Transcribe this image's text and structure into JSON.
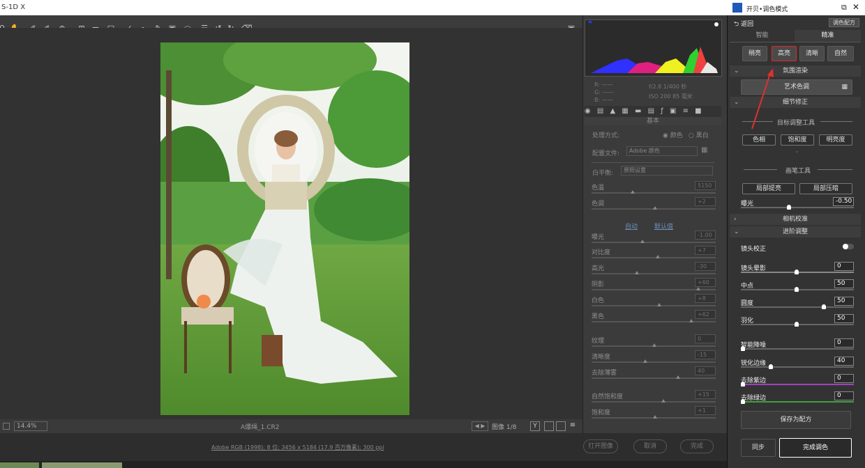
{
  "app": {
    "title": "S-1D X"
  },
  "bottombar": {
    "zoom": "14.4%",
    "filename": "A爆绳_1.CR2",
    "image_count": "图像 1/8"
  },
  "statusbar": {
    "info": "Adobe RGB (1998); 8 位; 3456 x 5184 (17.9 百万像素); 300 ppi",
    "open_label": "打开图像",
    "cancel_label": "取消",
    "done_label": "完成"
  },
  "histogram": {
    "r": "R:",
    "g": "G:",
    "b": "B:",
    "dash": "——",
    "aperture": "f/2.8  1/400 秒",
    "iso": "ISO 200  85 毫米"
  },
  "basic": {
    "section": "基本",
    "process_label": "处理方式:",
    "color": "颜色",
    "bw": "黑白",
    "profile_label": "配置文件:",
    "profile": "Adobe 颜色",
    "wb_label": "白平衡:",
    "wb_value": "原照设置",
    "auto": "自动",
    "default": "默认值",
    "sliders": [
      {
        "label": "色温",
        "value": "5150"
      },
      {
        "label": "色调",
        "value": "+2"
      },
      {
        "label": "曝光",
        "value": "-1.00"
      },
      {
        "label": "对比度",
        "value": "+7"
      },
      {
        "label": "高光",
        "value": "-30"
      },
      {
        "label": "阴影",
        "value": "+60"
      },
      {
        "label": "白色",
        "value": "+8"
      },
      {
        "label": "黑色",
        "value": "+62"
      },
      {
        "label": "纹理",
        "value": "0"
      },
      {
        "label": "清晰度",
        "value": "-15"
      },
      {
        "label": "去除薄雾",
        "value": "40"
      },
      {
        "label": "自然饱和度",
        "value": "+15"
      },
      {
        "label": "饱和度",
        "value": "+1"
      }
    ]
  },
  "plugin": {
    "title": "开贝•调色模式",
    "back": "返回",
    "preset_btn": "调色配方",
    "tabs": [
      "智能",
      "精准"
    ],
    "styles": [
      "稍亮",
      "高亮",
      "清晰",
      "自然"
    ],
    "sec_ambient": "氛围渲染",
    "art_color": "艺术色调",
    "sec_detail": "细节修正",
    "target_tool": "目标调整工具",
    "target_btns": [
      "色相",
      "饱和度",
      "明亮度"
    ],
    "brush_tool": "画笔工具",
    "brush_btns": [
      "局部提亮",
      "局部压暗"
    ],
    "exposure_label": "曝光",
    "exposure_value": "-0.50",
    "sec_camera": "相机校准",
    "sec_advanced": "进阶调整",
    "lens_correct": "镜头校正",
    "adv_sliders": [
      {
        "label": "镜头晕影",
        "value": "0"
      },
      {
        "label": "中点",
        "value": "50"
      },
      {
        "label": "圆度",
        "value": "50"
      },
      {
        "label": "羽化",
        "value": "50"
      },
      {
        "label": "智能降噪",
        "value": "0"
      },
      {
        "label": "锐化边缘",
        "value": "40"
      },
      {
        "label": "去除紫边",
        "value": "0"
      },
      {
        "label": "去除绿边",
        "value": "0"
      }
    ],
    "save_preset": "保存为配方",
    "sync": "同步",
    "finish": "完成调色"
  }
}
